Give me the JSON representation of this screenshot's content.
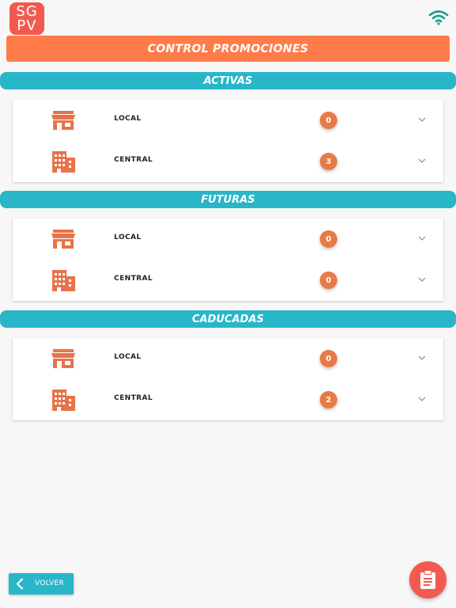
{
  "app": {
    "logo_line1": "SG",
    "logo_line2": "PV",
    "title": "CONTROL PROMOCIONES"
  },
  "colors": {
    "primary": "#ff7b4a",
    "section": "#29b6c9",
    "badge": "#e87a45",
    "logo": "#f25a4f",
    "wifi": "#1a9e8f"
  },
  "sections": [
    {
      "title": "ACTIVAS",
      "rows": [
        {
          "icon": "store-icon",
          "label": "LOCAL",
          "count": "0"
        },
        {
          "icon": "building-icon",
          "label": "CENTRAL",
          "count": "3"
        }
      ]
    },
    {
      "title": "FUTURAS",
      "rows": [
        {
          "icon": "store-icon",
          "label": "LOCAL",
          "count": "0"
        },
        {
          "icon": "building-icon",
          "label": "CENTRAL",
          "count": "0"
        }
      ]
    },
    {
      "title": "CADUCADAS",
      "rows": [
        {
          "icon": "store-icon",
          "label": "LOCAL",
          "count": "0"
        },
        {
          "icon": "building-icon",
          "label": "CENTRAL",
          "count": "2"
        }
      ]
    }
  ],
  "footer": {
    "back_label": "VOLVER",
    "fab_icon": "clipboard-icon"
  }
}
